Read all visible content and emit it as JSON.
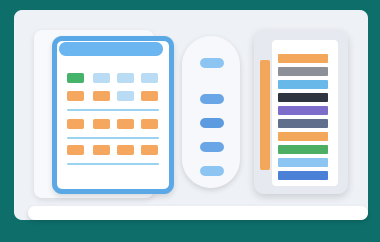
{
  "colors": {
    "background": "#0e6f6a",
    "board": "#eef1f6",
    "calendar_border": "#5aa8e6",
    "calendar_header": "#6bb6f0",
    "cell_green": "#46b36b",
    "cell_orange": "#f5a760",
    "cell_blue": "#b9dcf4",
    "pill_blue": "#5d9be0",
    "pill_light": "#8cc4f2",
    "book_spine": "#f2a75b"
  },
  "calendar": {
    "icon": "calendar-illustration"
  },
  "control_panel": {
    "icon": "slider-pill-panel"
  },
  "book": {
    "icon": "book-with-color-stripes",
    "stripes": [
      "#f2a75b",
      "#8c9099",
      "#68b8ea",
      "#2e3440",
      "#7d6cc9",
      "#5f6f8c",
      "#f2a75b",
      "#4caf64",
      "#8cc4f2",
      "#4a80d6"
    ]
  }
}
